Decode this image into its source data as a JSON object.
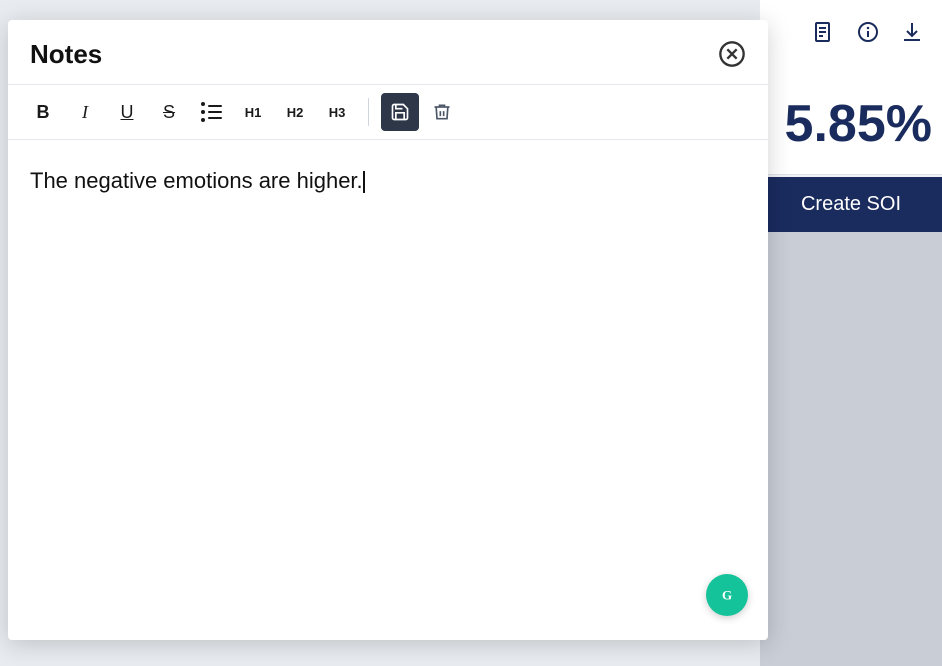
{
  "notes": {
    "title": "Notes",
    "close_label": "×",
    "note_content": "The negative emotions are higher.",
    "toolbar": {
      "bold_label": "B",
      "italic_label": "I",
      "underline_label": "U",
      "strikethrough_label": "S",
      "h1_label": "H1",
      "h2_label": "H2",
      "h3_label": "H3"
    }
  },
  "background": {
    "percentage": "5.85%",
    "create_soi_label": "Create SOI"
  },
  "icons": {
    "document": "📄",
    "info": "ℹ",
    "download": "⬇"
  }
}
